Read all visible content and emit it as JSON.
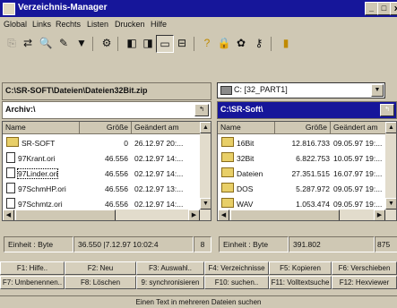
{
  "window": {
    "title": "Verzeichnis-Manager",
    "btn_min": "_",
    "btn_max": "□",
    "btn_close": "x"
  },
  "menu": {
    "global": "Global",
    "links": "Links",
    "rechts": "Rechts",
    "listen": "Listen",
    "drucken": "Drucken",
    "hilfe": "Hilfe"
  },
  "left": {
    "path": "C:\\SR-SOFT\\Dateien\\Dateien32Bit.zip",
    "archive_label": "Archiv:\\",
    "col_name": "Name",
    "col_size": "Größe",
    "col_date": "Geändert am",
    "rows": [
      {
        "name": "SR-SOFT",
        "size": "0",
        "date": "26.12.97 20:..."
      },
      {
        "name": "97Krant.ori",
        "size": "46.556",
        "date": "02.12.97 14:..."
      },
      {
        "name": "97Linder.ori",
        "size": "46.556",
        "date": "02.12.97 14:..."
      },
      {
        "name": "97SchmHP.ori",
        "size": "46.556",
        "date": "02.12.97 13:..."
      },
      {
        "name": "97Schmtz.ori",
        "size": "46.556",
        "date": "02.12.97 14:..."
      }
    ],
    "status_unit": "Einheit : Byte",
    "status_info": "36.550 |7.12.97 10:02:4",
    "status_count": "8"
  },
  "right": {
    "drive": "C: [32_PART1]",
    "path": "C:\\SR-Soft\\",
    "col_name": "Name",
    "col_size": "Größe",
    "col_date": "Geändert am",
    "rows": [
      {
        "name": "16Bit",
        "size": "12.816.733",
        "date": "09.05.97 19:..."
      },
      {
        "name": "32Bit",
        "size": "6.822.753",
        "date": "10.05.97 19:..."
      },
      {
        "name": "Dateien",
        "size": "27.351.515",
        "date": "16.07.97 19:..."
      },
      {
        "name": "DOS",
        "size": "5.287.972",
        "date": "09.05.97 19:..."
      },
      {
        "name": "WAV",
        "size": "1.053.474",
        "date": "09.05.97 19:..."
      }
    ],
    "status_unit": "Einheit : Byte",
    "status_info": "391.802",
    "status_count": "875"
  },
  "fkeys_row1": [
    "F1: Hilfe..",
    "F2: Neu",
    "F3: Auswahl..",
    "F4: Verzeichnisse",
    "F5: Kopieren",
    "F6: Verschieben"
  ],
  "fkeys_row2": [
    "F7: Umbenennen..",
    "F8: Löschen",
    "9: synchronisieren",
    "F10: suchen..",
    "F11: Volltextsuche",
    "F12: Hexviewer"
  ],
  "footer": "Einen Text in mehreren Dateien suchen",
  "icons": [
    "copy-icon",
    "move-icon",
    "view-icon",
    "edit-icon",
    "filter-icon",
    "tools-icon",
    "split-icon",
    "compare-icon",
    "window-icon",
    "layout-icon",
    "help-icon",
    "lock-icon",
    "info-icon",
    "key-icon",
    "exit-icon"
  ]
}
